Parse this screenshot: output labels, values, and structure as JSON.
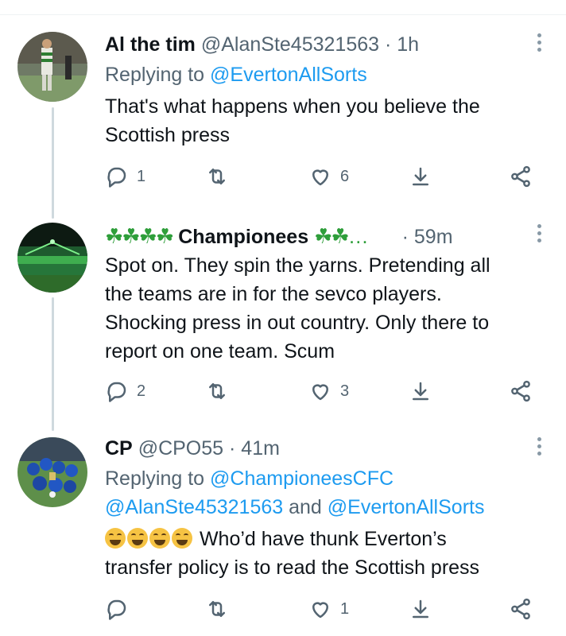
{
  "tweets": [
    {
      "name": "Al the tim",
      "handle": "@AlanSte45321563",
      "time": "1h",
      "reply_prefix": "Replying to",
      "reply_to": "@EvertonAllSorts",
      "text_lines": [
        "That's what happens when you believe the",
        "Scottish press"
      ],
      "replies": "1",
      "retweets": "",
      "likes": "6"
    },
    {
      "name_prefix_icons": "☘☘☘☘",
      "name": "Championees",
      "name_suffix_icons": "☘☘…",
      "time": "59m",
      "text_lines": [
        "Spot on. They spin the yarns. Pretending all",
        "the teams are in for the sevco players.",
        "Shocking press in out country. Only there to",
        "report on one team. Scum"
      ],
      "replies": "2",
      "retweets": "",
      "likes": "3"
    },
    {
      "name": "CP",
      "handle": "@CPO55",
      "time": "41m",
      "reply_prefix": "Replying to",
      "reply_to_1": "@ChampioneesCFC",
      "reply_to_2": "@AlanSte45321563",
      "reply_and": "and",
      "reply_to_3": "@EvertonAllSorts",
      "text_line_1": "Who’d have thunk Everton’s",
      "text_line_2": "transfer policy is to read the Scottish press",
      "emoji_name": "face-with-tears-of-joy",
      "replies": "",
      "retweets": "",
      "likes": "1"
    }
  ],
  "colors": {
    "link": "#1d9bf0",
    "secondary_text": "#536471",
    "thread_line": "#cfd9de",
    "clover": "#2e9e3a"
  },
  "icons": [
    "reply-icon",
    "retweet-icon",
    "like-icon",
    "download-icon",
    "share-icon",
    "more-icon"
  ]
}
